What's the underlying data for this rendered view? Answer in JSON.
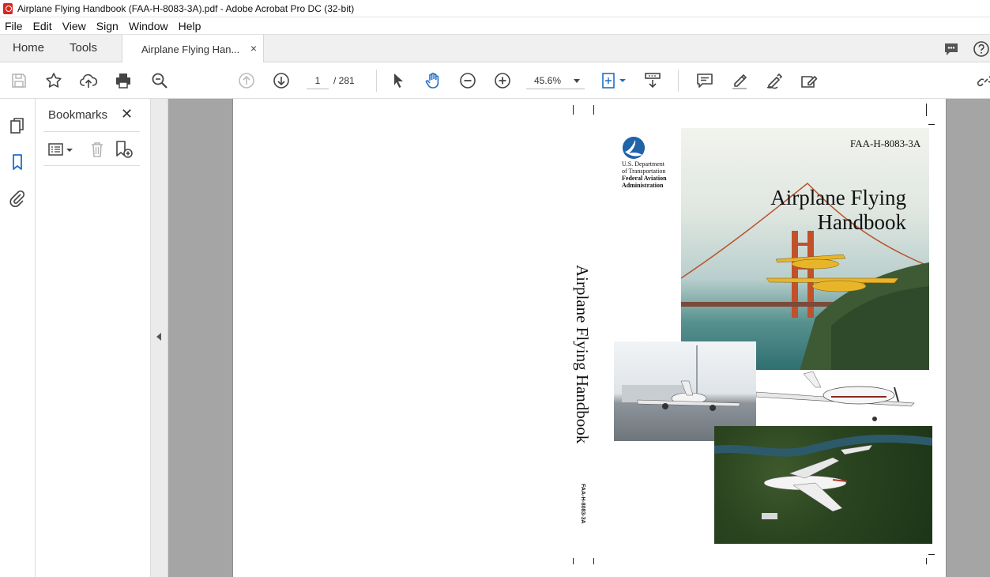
{
  "window": {
    "title": "Airplane Flying Handbook (FAA-H-8083-3A).pdf - Adobe Acrobat Pro DC (32-bit)"
  },
  "menu": [
    "File",
    "Edit",
    "View",
    "Sign",
    "Window",
    "Help"
  ],
  "tabs": {
    "home": "Home",
    "tools": "Tools",
    "document": "Airplane Flying Han...",
    "close_glyph": "×"
  },
  "toolbar": {
    "page_current": "1",
    "page_total": "/ 281",
    "zoom": "45.6%"
  },
  "bookmarks": {
    "title": "Bookmarks",
    "close_glyph": "✕"
  },
  "document": {
    "spine_title": "Airplane Flying Handbook",
    "spine_code": "FAA-H-8083-3A",
    "publisher_line1": "U.S. Department",
    "publisher_line2": "of Transportation",
    "publisher_line3": "Federal Aviation",
    "publisher_line4": "Administration",
    "cover_code": "FAA-H-8083-3A",
    "cover_title_line1": "Airplane Flying",
    "cover_title_line2": "Handbook"
  },
  "colors": {
    "acrobat_red": "#d7261e",
    "dot_blue": "#1f63a8",
    "doc_background": "#a5a5a5"
  }
}
